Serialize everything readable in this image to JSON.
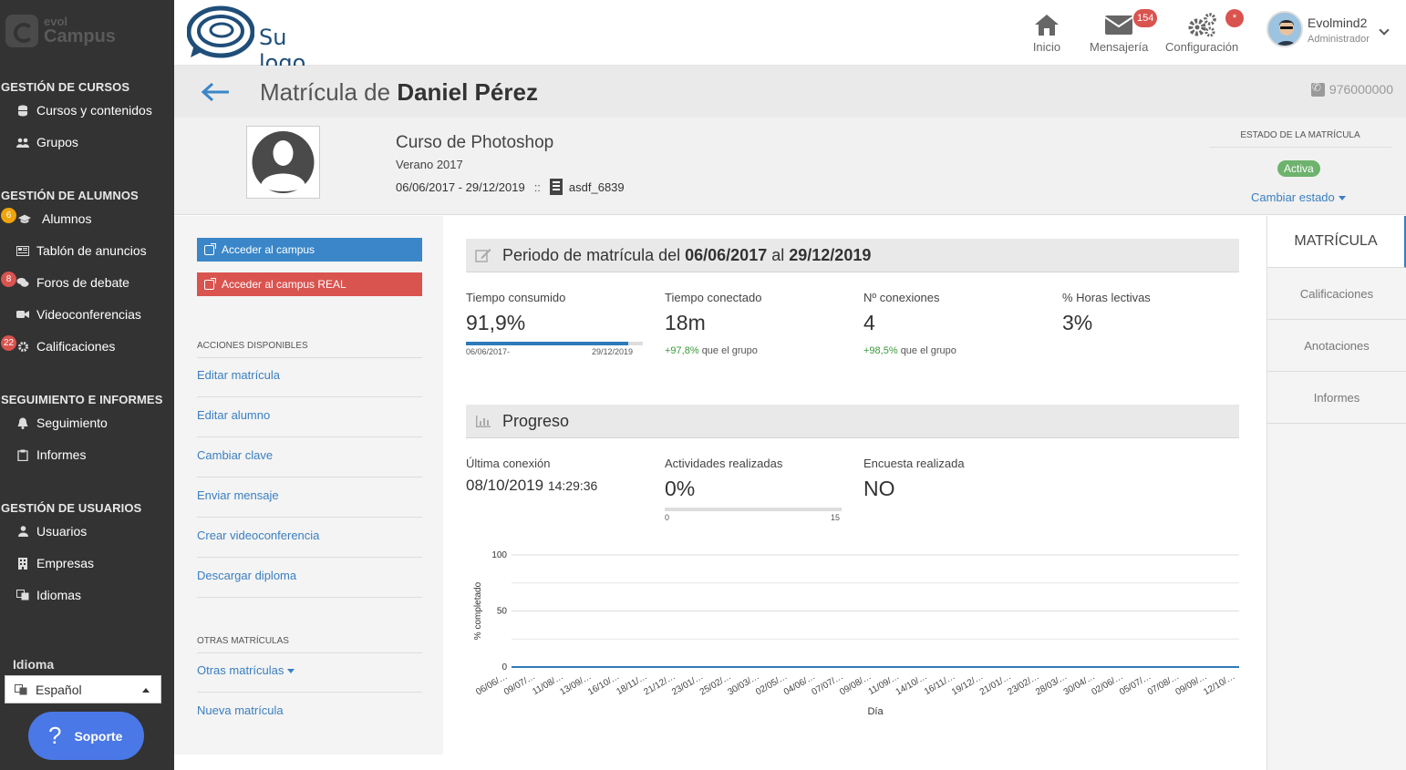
{
  "sidebar": {
    "brand_top": "evol",
    "brand_bottom": "Campus",
    "sections": [
      {
        "title": "GESTIÓN DE CURSOS",
        "items": [
          {
            "label": "Cursos y contenidos",
            "icon": "database-icon"
          },
          {
            "label": "Grupos",
            "icon": "users-icon"
          }
        ]
      },
      {
        "title": "GESTIÓN DE ALUMNOS",
        "items": [
          {
            "label": "Alumnos",
            "icon": "graduation-cap-icon",
            "badge": "6"
          },
          {
            "label": "Tablón de anuncios",
            "icon": "newspaper-icon"
          },
          {
            "label": "Foros de debate",
            "icon": "comments-icon",
            "badge": "8"
          },
          {
            "label": "Videoconferencias",
            "icon": "video-camera-icon"
          },
          {
            "label": "Calificaciones",
            "icon": "gears-icon",
            "badge": "22"
          }
        ]
      },
      {
        "title": "SEGUIMIENTO E INFORMES",
        "items": [
          {
            "label": "Seguimiento",
            "icon": "bell-icon"
          },
          {
            "label": "Informes",
            "icon": "clipboard-icon"
          }
        ]
      },
      {
        "title": "GESTIÓN DE USUARIOS",
        "items": [
          {
            "label": "Usuarios",
            "icon": "user-icon"
          },
          {
            "label": "Empresas",
            "icon": "building-icon"
          },
          {
            "label": "Idiomas",
            "icon": "language-icon"
          }
        ]
      }
    ],
    "idioma_label": "Idioma",
    "language_value": "Español",
    "support_label": "Soporte"
  },
  "topbar": {
    "logo_text": "Su logo",
    "nav": [
      {
        "label": "Inicio",
        "icon": "home-icon"
      },
      {
        "label": "Mensajería",
        "icon": "envelope-icon",
        "badge": "154"
      },
      {
        "label": "Configuración",
        "icon": "gears-icon",
        "badge": "*"
      }
    ],
    "user_name": "Evolmind2",
    "user_role": "Administrador"
  },
  "title": {
    "prefix": "Matrícula de",
    "student": "Daniel Pérez",
    "phone": "976000000"
  },
  "course": {
    "name": "Curso de Photoshop",
    "edition": "Verano 2017",
    "dates": "06/06/2017 - 29/12/2019",
    "separator": "::",
    "group_code": "asdf_6839"
  },
  "estado": {
    "label": "ESTADO DE LA MATRÍCULA",
    "status": "Activa",
    "change_label": "Cambiar estado",
    "status_color": "#6db36d"
  },
  "actions": {
    "btn_campus": "Acceder al campus",
    "btn_campus_real": "Acceder al campus REAL",
    "available_title": "ACCIONES DISPONIBLES",
    "links": [
      "Editar matrícula",
      "Editar alumno",
      "Cambiar clave",
      "Enviar mensaje",
      "Crear videoconferencia",
      "Descargar diploma"
    ],
    "other_title": "OTRAS MATRÍCULAS",
    "other_links": [
      "Otras matrículas",
      "Nueva matrícula"
    ],
    "btn_campus_color": "#3a86c8",
    "btn_campus_real_color": "#d9534f"
  },
  "periodo": {
    "prefix": "Periodo de matrícula del",
    "start": "06/06/2017",
    "mid": "al",
    "end": "29/12/2019",
    "stats": [
      {
        "label": "Tiempo consumido",
        "value": "91,9%",
        "bar_fraction": 0.919,
        "bar_start": "06/06/2017-",
        "bar_end": "29/12/2019"
      },
      {
        "label": "Tiempo conectado",
        "value": "18m",
        "cmp_value": "+97,8%",
        "cmp_text": "que el grupo"
      },
      {
        "label": "Nº conexiones",
        "value": "4",
        "cmp_value": "+98,5%",
        "cmp_text": "que el grupo"
      },
      {
        "label": "% Horas lectivas",
        "value": "3%"
      }
    ]
  },
  "progreso": {
    "title": "Progreso",
    "last_conn_label": "Última conexión",
    "last_conn_date": "08/10/2019",
    "last_conn_time": "14:29:36",
    "activities_label": "Actividades realizadas",
    "activities_value": "0%",
    "activities_fraction": 0,
    "activities_min": "0",
    "activities_max": "15",
    "survey_label": "Encuesta realizada",
    "survey_value": "NO"
  },
  "chart_data": {
    "type": "line",
    "xlabel": "Día",
    "ylabel": "% completado",
    "ylim": [
      0,
      100
    ],
    "yticks": [
      0,
      50,
      100
    ],
    "categories": [
      "06/06/…",
      "09/07/…",
      "11/08/…",
      "13/09/…",
      "16/10/…",
      "18/11/…",
      "21/12/…",
      "23/01/…",
      "25/02/…",
      "30/03/…",
      "02/05/…",
      "04/06/…",
      "07/07/…",
      "09/08/…",
      "11/09/…",
      "14/10/…",
      "16/11/…",
      "19/12/…",
      "21/01/…",
      "23/02/…",
      "28/03/…",
      "30/04/…",
      "02/06/…",
      "05/07/…",
      "07/08/…",
      "09/09/…",
      "12/10/…"
    ],
    "series": [
      {
        "values": [
          0,
          0,
          0,
          0,
          0,
          0,
          0,
          0,
          0,
          0,
          0,
          0,
          0,
          0,
          0,
          0,
          0,
          0,
          0,
          0,
          0,
          0,
          0,
          0,
          0,
          0,
          0
        ],
        "color": "#2e7ab8"
      }
    ],
    "grid": true
  },
  "tabs": [
    "MATRÍCULA",
    "Calificaciones",
    "Anotaciones",
    "Informes"
  ]
}
